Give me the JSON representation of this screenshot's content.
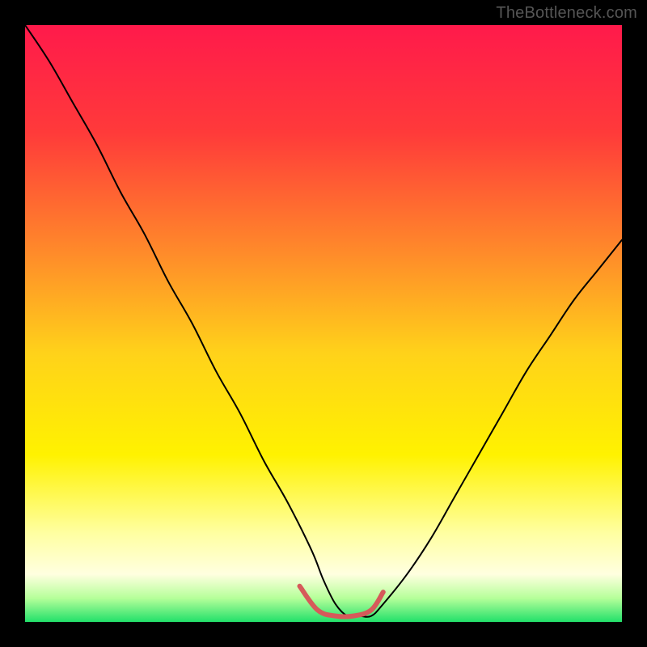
{
  "watermark": "TheBottleneck.com",
  "chart_data": {
    "type": "line",
    "title": "",
    "xlabel": "",
    "ylabel": "",
    "xlim": [
      0,
      100
    ],
    "ylim": [
      0,
      100
    ],
    "grid": false,
    "legend": false,
    "gradient_stops": [
      {
        "offset": 0.0,
        "color": "#ff1a4b"
      },
      {
        "offset": 0.18,
        "color": "#ff3a3a"
      },
      {
        "offset": 0.38,
        "color": "#ff8a2a"
      },
      {
        "offset": 0.55,
        "color": "#ffd21a"
      },
      {
        "offset": 0.72,
        "color": "#fff200"
      },
      {
        "offset": 0.85,
        "color": "#ffffa0"
      },
      {
        "offset": 0.92,
        "color": "#ffffe0"
      },
      {
        "offset": 0.96,
        "color": "#b6ff9a"
      },
      {
        "offset": 1.0,
        "color": "#22e06a"
      }
    ],
    "series": [
      {
        "name": "bottleneck-curve",
        "stroke": "#000000",
        "stroke_width": 2,
        "x": [
          0,
          4,
          8,
          12,
          16,
          20,
          24,
          28,
          32,
          36,
          40,
          44,
          48,
          50,
          52,
          54,
          56,
          58,
          60,
          64,
          68,
          72,
          76,
          80,
          84,
          88,
          92,
          96,
          100
        ],
        "y": [
          100,
          94,
          87,
          80,
          72,
          65,
          57,
          50,
          42,
          35,
          27,
          20,
          12,
          7,
          3,
          1,
          1,
          1,
          3,
          8,
          14,
          21,
          28,
          35,
          42,
          48,
          54,
          59,
          64
        ]
      },
      {
        "name": "valley-highlight",
        "stroke": "#d65a5a",
        "stroke_width": 6,
        "x": [
          46,
          49,
          52,
          55,
          58,
          60
        ],
        "y": [
          6,
          2,
          1,
          1,
          2,
          5
        ]
      }
    ]
  }
}
